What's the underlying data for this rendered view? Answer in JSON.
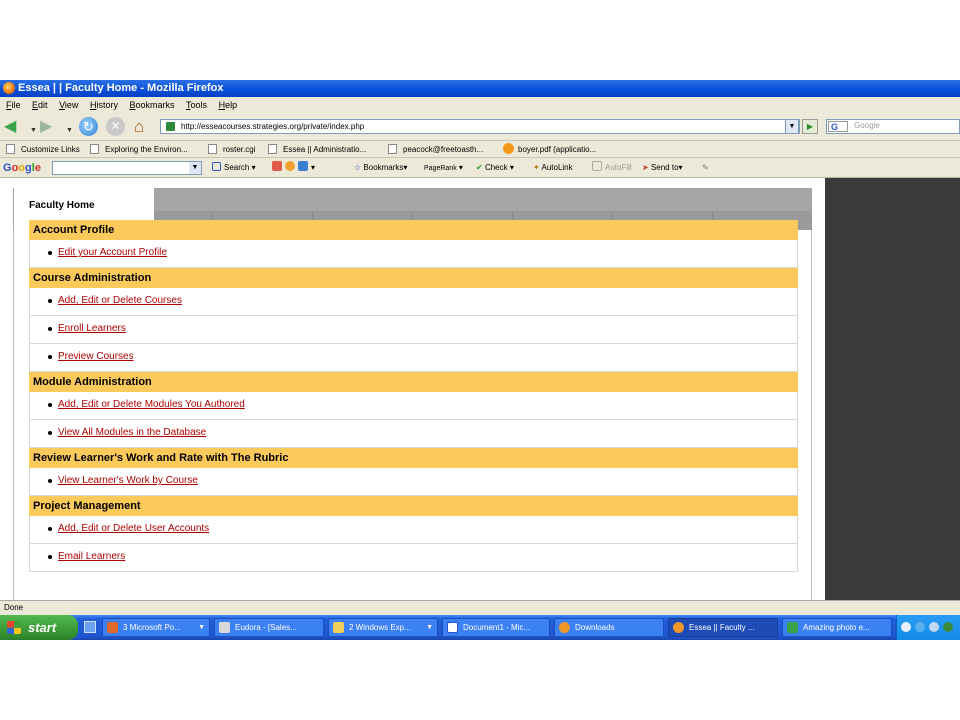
{
  "window": {
    "title": "Essea | | Faculty Home - Mozilla Firefox"
  },
  "menu": [
    "File",
    "Edit",
    "View",
    "History",
    "Bookmarks",
    "Tools",
    "Help"
  ],
  "nav": {
    "url": "http://esseacourses.strategies.org/private/index.php",
    "search_placeholder": "Google",
    "search_engine_letter": "G"
  },
  "bookmarks": [
    "Customize Links",
    "Exploring the Environ...",
    "roster.cgi",
    "Essea || Administratio...",
    "peacock@freetoasth...",
    "boyer.pdf (applicatio..."
  ],
  "google_toolbar": {
    "logo": [
      "G",
      "o",
      "o",
      "g",
      "l",
      "e"
    ],
    "search_label": "Search",
    "bookmarks_label": "Bookmarks",
    "pagerank_label": "PageRank",
    "check_label": "Check",
    "autolink_label": "AutoLink",
    "autofill_label": "AutoFill",
    "sendto_label": "Send to",
    "g_letter": "G"
  },
  "page": {
    "active_tab": "Faculty Home",
    "sections": [
      {
        "title": "Account Profile",
        "links": [
          "Edit your Account Profile"
        ]
      },
      {
        "title": "Course Administration",
        "links": [
          "Add, Edit or Delete Courses",
          "Enroll Learners",
          "Preview Courses"
        ]
      },
      {
        "title": "Module Administration",
        "links": [
          "Add, Edit or Delete Modules You Authored",
          "View All Modules in the Database"
        ]
      },
      {
        "title": "Review Learner's Work and Rate with The Rubric",
        "links": [
          "View Learner's Work by Course"
        ]
      },
      {
        "title": "Project Management",
        "links": [
          "Add, Edit or Delete User Accounts",
          "Email Learners"
        ]
      }
    ]
  },
  "status": "Done",
  "taskbar": {
    "start_label": "start",
    "tasks": [
      "3 Microsoft Po...",
      "Eudora - [Sales...",
      "2 Windows Exp...",
      "Document1 - Mic...",
      "Downloads",
      "Essea || Faculty ...",
      "Amazing photo e..."
    ]
  },
  "colors": {
    "section_header": "#fcc95b",
    "link": "#b00000",
    "titlebar": "#0a4fd8"
  }
}
